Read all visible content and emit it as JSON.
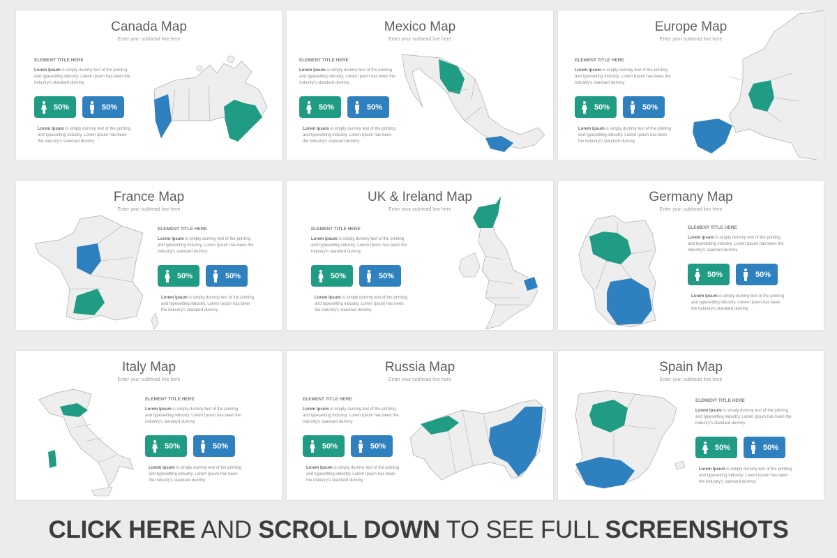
{
  "colors": {
    "teal": "#1f9c83",
    "blue": "#2f80bf",
    "land": "#eeeeee"
  },
  "subtitle": "Enter your subhead line here",
  "element_title": "ELEMENT TITLE HERE",
  "lorem_bold": "Lorem Ipsum",
  "lorem_rest": " is simply dummy text of the printing and typesetting industry. Lorem Ipsum has been the industry's standard dummy",
  "stat_female": "50%",
  "stat_male": "50%",
  "slides": [
    {
      "title": "Canada Map"
    },
    {
      "title": "Mexico Map"
    },
    {
      "title": "Europe Map"
    },
    {
      "title": "France Map"
    },
    {
      "title": "UK & Ireland Map"
    },
    {
      "title": "Germany Map"
    },
    {
      "title": "Italy Map"
    },
    {
      "title": "Russia Map"
    },
    {
      "title": "Spain Map"
    }
  ],
  "footer": {
    "part1": "CLICK HERE",
    "part2": " AND ",
    "part3": "SCROLL DOWN",
    "part4": " TO SEE FULL ",
    "part5": "SCREENSHOTS"
  }
}
